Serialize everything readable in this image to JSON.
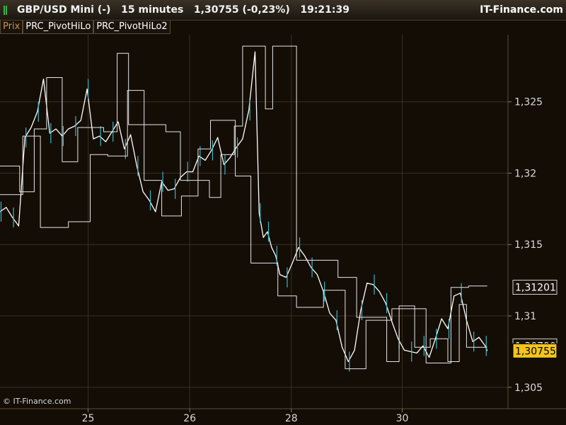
{
  "window": {
    "title": "GBP/USD Mini (-)   15 minutes   1,30755 (-0,23%)   19:21:39",
    "brand": "IT-Finance.com"
  },
  "tabs": [
    {
      "label": "Prix"
    },
    {
      "label": "PRC_PivotHiLo"
    },
    {
      "label": "PRC_PivotHiLo2"
    }
  ],
  "copyright": "© IT-Finance.com",
  "colors": {
    "background": "#140d06",
    "grid": "#3a2f22",
    "price_line": "#ffffff",
    "candle_accent": "#3bb5c4",
    "pivot_line": "#e6e6e6",
    "last_price_badge": "#f5c518",
    "axis_text": "#d8d8d8"
  },
  "chart_data": {
    "type": "line",
    "title": "",
    "xlabel": "",
    "ylabel": "",
    "ylim": [
      1.3035,
      1.3297
    ],
    "y_ticks": [
      {
        "value": 1.325,
        "label": "1,325"
      },
      {
        "value": 1.32,
        "label": "1,32"
      },
      {
        "value": 1.315,
        "label": "1,315"
      },
      {
        "value": 1.31,
        "label": "1,31"
      },
      {
        "value": 1.305,
        "label": "1,305"
      }
    ],
    "x_ticks": [
      {
        "label": "25",
        "pos": 8.5
      },
      {
        "label": "26",
        "pos": 18.3
      },
      {
        "label": "28",
        "pos": 28.1
      },
      {
        "label": "30",
        "pos": 38.8
      }
    ],
    "grid": true,
    "price_labels": [
      {
        "value": 1.31201,
        "label": "1,31201",
        "style": "outline"
      },
      {
        "value": 1.3079,
        "label": "1,30790",
        "style": "outline"
      },
      {
        "value": 1.30755,
        "label": "1,30755",
        "style": "highlight"
      }
    ],
    "series": [
      {
        "role": "price",
        "x": [
          0,
          0.6,
          1.2,
          1.8,
          2.4,
          3,
          3.6,
          4.2,
          4.8,
          5.4,
          6,
          6.6,
          7.2,
          7.8,
          8.4,
          9,
          9.6,
          10.2,
          10.8,
          11.4,
          12,
          12.6,
          13.2,
          13.8,
          14.4,
          15,
          15.6,
          16.2,
          16.8,
          17.4,
          18,
          18.6,
          19.2,
          19.8,
          20.4,
          21,
          21.6,
          22.2,
          22.8,
          23.4,
          24,
          24.6,
          25,
          25.4,
          25.8,
          26.2,
          26.6,
          27,
          27.6,
          28.2,
          28.8,
          29.4,
          30,
          30.6,
          31.2,
          31.8,
          32.4,
          33,
          33.6,
          34.2,
          34.8,
          35.4,
          36,
          36.6,
          37.2,
          37.8,
          38.4,
          39,
          39.6,
          40.2,
          40.8,
          41.4,
          42,
          42.6,
          43.2,
          43.8,
          44.4,
          45,
          45.6,
          46.2,
          46.8,
          47
        ],
        "values": [
          1.3173,
          1.3176,
          1.3169,
          1.3163,
          1.3225,
          1.3232,
          1.3243,
          1.3266,
          1.3228,
          1.3231,
          1.3226,
          1.3231,
          1.3233,
          1.3237,
          1.3259,
          1.3224,
          1.3226,
          1.3222,
          1.3229,
          1.3236,
          1.3217,
          1.3227,
          1.3205,
          1.3187,
          1.3181,
          1.3173,
          1.3194,
          1.3188,
          1.3189,
          1.3197,
          1.3201,
          1.3201,
          1.3212,
          1.3209,
          1.3216,
          1.3225,
          1.3206,
          1.3211,
          1.3218,
          1.3224,
          1.3244,
          1.3285,
          1.3172,
          1.3155,
          1.3159,
          1.3148,
          1.3142,
          1.3129,
          1.3127,
          1.3137,
          1.3148,
          1.3142,
          1.3134,
          1.3129,
          1.3117,
          1.3102,
          1.3097,
          1.3078,
          1.3068,
          1.3076,
          1.3104,
          1.3123,
          1.3122,
          1.3117,
          1.3109,
          1.3096,
          1.3084,
          1.3076,
          1.3075,
          1.3074,
          1.3079,
          1.3071,
          1.3084,
          1.3098,
          1.3091,
          1.3114,
          1.3116,
          1.3097,
          1.3082,
          1.3085,
          1.3079,
          1.30755
        ]
      },
      {
        "role": "pivot",
        "x": [
          0,
          1.9,
          1.9,
          3.3,
          3.3,
          4.5,
          4.5,
          6,
          6,
          7.5,
          7.5,
          10,
          10,
          11.3,
          11.3,
          12.4,
          12.4,
          16,
          16,
          17.4,
          17.4,
          20.2,
          20.2,
          21.3,
          21.3,
          22.6,
          22.6,
          23.4,
          23.4,
          25.6,
          25.6,
          26.3,
          26.3,
          28.6,
          28.6,
          32.6,
          32.6,
          34.4,
          34.4,
          37.3,
          37.3,
          38.5,
          38.5,
          40,
          40,
          41.5,
          41.5,
          43.2,
          43.2,
          44.3,
          44.3,
          45,
          45,
          47
        ],
        "values": [
          1.3205,
          1.3205,
          1.3187,
          1.3187,
          1.3231,
          1.3231,
          1.3267,
          1.3267,
          1.3208,
          1.3208,
          1.3232,
          1.3232,
          1.3229,
          1.3229,
          1.3284,
          1.3284,
          1.3234,
          1.3234,
          1.3229,
          1.3229,
          1.3195,
          1.3195,
          1.3183,
          1.3183,
          1.3213,
          1.3213,
          1.3233,
          1.3233,
          1.3289,
          1.3289,
          1.3245,
          1.3245,
          1.3289,
          1.3289,
          1.3139,
          1.3139,
          1.3127,
          1.3127,
          1.3099,
          1.3099,
          1.3068,
          1.3068,
          1.3107,
          1.3107,
          1.3078,
          1.3078,
          1.3084,
          1.3084,
          1.3068,
          1.3068,
          1.3108,
          1.3108,
          1.3078,
          1.3078
        ]
      },
      {
        "role": "pivot2",
        "x": [
          0,
          2.2,
          2.2,
          3.9,
          3.9,
          6.6,
          6.6,
          8.7,
          8.7,
          10.4,
          10.4,
          12.3,
          12.3,
          13.9,
          13.9,
          15.6,
          15.6,
          17.5,
          17.5,
          19.1,
          19.1,
          20.3,
          20.3,
          22.7,
          22.7,
          24.2,
          24.2,
          26.8,
          26.8,
          28.6,
          28.6,
          31.2,
          31.2,
          33.3,
          33.3,
          35.3,
          35.3,
          37.8,
          37.8,
          41.1,
          41.1,
          43.5,
          43.5,
          45.2,
          45.2,
          47
        ],
        "values": [
          1.3185,
          1.3185,
          1.3226,
          1.3226,
          1.3162,
          1.3162,
          1.3166,
          1.3166,
          1.3213,
          1.3213,
          1.3212,
          1.3212,
          1.3258,
          1.3258,
          1.3195,
          1.3195,
          1.317,
          1.317,
          1.3184,
          1.3184,
          1.3217,
          1.3217,
          1.3237,
          1.3237,
          1.3198,
          1.3198,
          1.3137,
          1.3137,
          1.3114,
          1.3114,
          1.3106,
          1.3106,
          1.3118,
          1.3118,
          1.3063,
          1.3063,
          1.3097,
          1.3097,
          1.3105,
          1.3105,
          1.3067,
          1.3067,
          1.312,
          1.312,
          1.3121,
          1.3121
        ]
      }
    ]
  }
}
